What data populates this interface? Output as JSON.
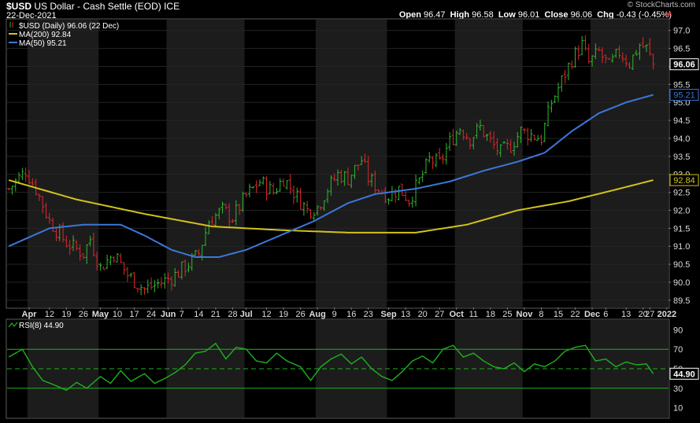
{
  "header": {
    "symbol": "$USD",
    "name": "US Dollar - Cash Settle (EOD)",
    "exchange": "ICE",
    "date": "22-Dec-2021",
    "copyright": "© StockCharts.com",
    "open_label": "Open",
    "open": "96.47",
    "high_label": "High",
    "high": "96.58",
    "low_label": "Low",
    "low": "96.01",
    "close_label": "Close",
    "close": "96.06",
    "chg_label": "Chg",
    "chg": "-0.43 (-0.45%)"
  },
  "chart_data": [
    {
      "type": "line",
      "panel": "price",
      "legend": [
        {
          "label": "$USD (Daily) 96.06 (22 Dec)",
          "color": "#ffffff"
        },
        {
          "label": "MA(200) 92.84",
          "color": "#d4c21a"
        },
        {
          "label": "MA(50) 95.21",
          "color": "#3b78d8"
        }
      ],
      "ylim": [
        89.3,
        97.3
      ],
      "yticks": [
        "97.0",
        "96.5",
        "96.0",
        "95.5",
        "95.0",
        "94.5",
        "94.0",
        "93.5",
        "93.0",
        "92.5",
        "92.0",
        "91.5",
        "91.0",
        "90.5",
        "90.0",
        "89.5"
      ],
      "last_value_tags": [
        {
          "value": 96.06,
          "label": "96.06",
          "color": "#ffffff"
        },
        {
          "value": 95.21,
          "label": "95.21",
          "color": "#3b78d8"
        },
        {
          "value": 92.84,
          "label": "92.84",
          "color": "#d4c21a"
        }
      ],
      "x_labels": [
        {
          "i": 6,
          "label": "Apr"
        },
        {
          "i": 12,
          "label": "12"
        },
        {
          "i": 17,
          "label": "19"
        },
        {
          "i": 22,
          "label": "26"
        },
        {
          "i": 27,
          "label": "May"
        },
        {
          "i": 32,
          "label": "10"
        },
        {
          "i": 37,
          "label": "17"
        },
        {
          "i": 42,
          "label": "24"
        },
        {
          "i": 47,
          "label": "Jun"
        },
        {
          "i": 51,
          "label": "7"
        },
        {
          "i": 56,
          "label": "14"
        },
        {
          "i": 61,
          "label": "21"
        },
        {
          "i": 66,
          "label": "28"
        },
        {
          "i": 70,
          "label": "Jul"
        },
        {
          "i": 76,
          "label": "12"
        },
        {
          "i": 81,
          "label": "19"
        },
        {
          "i": 86,
          "label": "26"
        },
        {
          "i": 91,
          "label": "Aug"
        },
        {
          "i": 96,
          "label": "9"
        },
        {
          "i": 101,
          "label": "16"
        },
        {
          "i": 106,
          "label": "23"
        },
        {
          "i": 112,
          "label": "Sep"
        },
        {
          "i": 117,
          "label": "13"
        },
        {
          "i": 122,
          "label": "20"
        },
        {
          "i": 127,
          "label": "27"
        },
        {
          "i": 132,
          "label": "Oct"
        },
        {
          "i": 137,
          "label": "11"
        },
        {
          "i": 142,
          "label": "18"
        },
        {
          "i": 147,
          "label": "25"
        },
        {
          "i": 152,
          "label": "Nov"
        },
        {
          "i": 157,
          "label": "8"
        },
        {
          "i": 162,
          "label": "15"
        },
        {
          "i": 167,
          "label": "22"
        },
        {
          "i": 172,
          "label": "Dec"
        },
        {
          "i": 176,
          "label": "6"
        },
        {
          "i": 182,
          "label": "13"
        },
        {
          "i": 187,
          "label": "20"
        },
        {
          "i": 189,
          "label": "27"
        },
        {
          "i": 194,
          "label": "2022"
        }
      ],
      "n_bars": 195,
      "month_bands": [
        [
          6,
          27
        ],
        [
          47,
          70
        ],
        [
          91,
          112
        ],
        [
          132,
          152
        ],
        [
          172,
          195
        ]
      ],
      "close_anchors": [
        [
          0,
          92.6
        ],
        [
          5,
          93.1
        ],
        [
          8,
          92.6
        ],
        [
          12,
          91.7
        ],
        [
          17,
          91.1
        ],
        [
          22,
          90.8
        ],
        [
          24,
          91.2
        ],
        [
          27,
          90.4
        ],
        [
          31,
          90.8
        ],
        [
          35,
          90.2
        ],
        [
          40,
          89.8
        ],
        [
          45,
          90.0
        ],
        [
          49,
          90.2
        ],
        [
          54,
          90.6
        ],
        [
          56,
          90.8
        ],
        [
          59,
          91.7
        ],
        [
          63,
          92.0
        ],
        [
          66,
          91.8
        ],
        [
          70,
          92.4
        ],
        [
          74,
          92.8
        ],
        [
          78,
          92.5
        ],
        [
          81,
          92.9
        ],
        [
          84,
          92.5
        ],
        [
          88,
          92.0
        ],
        [
          91,
          92.1
        ],
        [
          94,
          92.6
        ],
        [
          97,
          93.0
        ],
        [
          100,
          92.9
        ],
        [
          104,
          93.4
        ],
        [
          106,
          92.9
        ],
        [
          109,
          92.6
        ],
        [
          112,
          92.4
        ],
        [
          115,
          92.6
        ],
        [
          118,
          92.3
        ],
        [
          121,
          92.8
        ],
        [
          124,
          93.4
        ],
        [
          127,
          93.3
        ],
        [
          130,
          93.9
        ],
        [
          133,
          94.3
        ],
        [
          136,
          94.0
        ],
        [
          139,
          94.3
        ],
        [
          142,
          93.9
        ],
        [
          145,
          93.6
        ],
        [
          148,
          93.8
        ],
        [
          151,
          94.2
        ],
        [
          154,
          94.1
        ],
        [
          157,
          94.0
        ],
        [
          160,
          95.0
        ],
        [
          163,
          95.6
        ],
        [
          166,
          96.2
        ],
        [
          169,
          96.6
        ],
        [
          171,
          96.1
        ],
        [
          174,
          96.4
        ],
        [
          177,
          96.0
        ],
        [
          180,
          96.4
        ],
        [
          183,
          96.1
        ],
        [
          186,
          96.6
        ],
        [
          188,
          96.5
        ],
        [
          190,
          96.06
        ]
      ],
      "series": [
        {
          "name": "MA(200)",
          "color": "#d4c21a",
          "values": [
            [
              0,
              92.84
            ],
            [
              20,
              92.3
            ],
            [
              40,
              91.9
            ],
            [
              60,
              91.55
            ],
            [
              80,
              91.45
            ],
            [
              100,
              91.38
            ],
            [
              120,
              91.38
            ],
            [
              135,
              91.6
            ],
            [
              150,
              92.0
            ],
            [
              165,
              92.25
            ],
            [
              180,
              92.6
            ],
            [
              190,
              92.84
            ]
          ]
        },
        {
          "name": "MA(50)",
          "color": "#3b78d8",
          "values": [
            [
              0,
              91.0
            ],
            [
              12,
              91.5
            ],
            [
              22,
              91.6
            ],
            [
              33,
              91.6
            ],
            [
              40,
              91.3
            ],
            [
              48,
              90.9
            ],
            [
              55,
              90.7
            ],
            [
              62,
              90.7
            ],
            [
              70,
              90.9
            ],
            [
              80,
              91.3
            ],
            [
              90,
              91.7
            ],
            [
              100,
              92.2
            ],
            [
              108,
              92.45
            ],
            [
              120,
              92.6
            ],
            [
              130,
              92.8
            ],
            [
              140,
              93.1
            ],
            [
              150,
              93.35
            ],
            [
              158,
              93.6
            ],
            [
              166,
              94.2
            ],
            [
              174,
              94.7
            ],
            [
              182,
              95.0
            ],
            [
              190,
              95.21
            ]
          ]
        }
      ]
    },
    {
      "type": "line",
      "panel": "rsi",
      "legend": [
        {
          "label": "RSI(8) 44.90",
          "color": "#1db21d"
        }
      ],
      "ylim": [
        0,
        100
      ],
      "yticks": [
        "90",
        "70",
        "50",
        "30",
        "10"
      ],
      "levels": [
        70,
        50,
        30
      ],
      "last_value_tag": {
        "value": 44.9,
        "label": "44.90"
      },
      "series": [
        {
          "name": "RSI(8)",
          "color": "#1db21d",
          "values": [
            [
              0,
              62
            ],
            [
              4,
              70
            ],
            [
              7,
              52
            ],
            [
              10,
              38
            ],
            [
              13,
              34
            ],
            [
              17,
              28
            ],
            [
              20,
              36
            ],
            [
              23,
              30
            ],
            [
              27,
              42
            ],
            [
              30,
              35
            ],
            [
              33,
              48
            ],
            [
              36,
              37
            ],
            [
              40,
              45
            ],
            [
              43,
              35
            ],
            [
              46,
              40
            ],
            [
              49,
              46
            ],
            [
              52,
              54
            ],
            [
              55,
              66
            ],
            [
              58,
              68
            ],
            [
              61,
              76
            ],
            [
              64,
              60
            ],
            [
              67,
              72
            ],
            [
              70,
              70
            ],
            [
              73,
              58
            ],
            [
              76,
              56
            ],
            [
              79,
              66
            ],
            [
              82,
              58
            ],
            [
              86,
              52
            ],
            [
              89,
              38
            ],
            [
              92,
              52
            ],
            [
              95,
              60
            ],
            [
              98,
              65
            ],
            [
              101,
              55
            ],
            [
              104,
              62
            ],
            [
              107,
              50
            ],
            [
              110,
              42
            ],
            [
              113,
              38
            ],
            [
              116,
              47
            ],
            [
              119,
              58
            ],
            [
              122,
              63
            ],
            [
              125,
              56
            ],
            [
              128,
              70
            ],
            [
              131,
              74
            ],
            [
              134,
              62
            ],
            [
              137,
              66
            ],
            [
              140,
              58
            ],
            [
              143,
              52
            ],
            [
              146,
              50
            ],
            [
              149,
              56
            ],
            [
              152,
              47
            ],
            [
              155,
              55
            ],
            [
              158,
              52
            ],
            [
              161,
              58
            ],
            [
              164,
              68
            ],
            [
              167,
              72
            ],
            [
              170,
              74
            ],
            [
              173,
              58
            ],
            [
              176,
              60
            ],
            [
              179,
              52
            ],
            [
              182,
              57
            ],
            [
              185,
              54
            ],
            [
              188,
              55
            ],
            [
              190,
              44.9
            ]
          ]
        }
      ]
    }
  ]
}
